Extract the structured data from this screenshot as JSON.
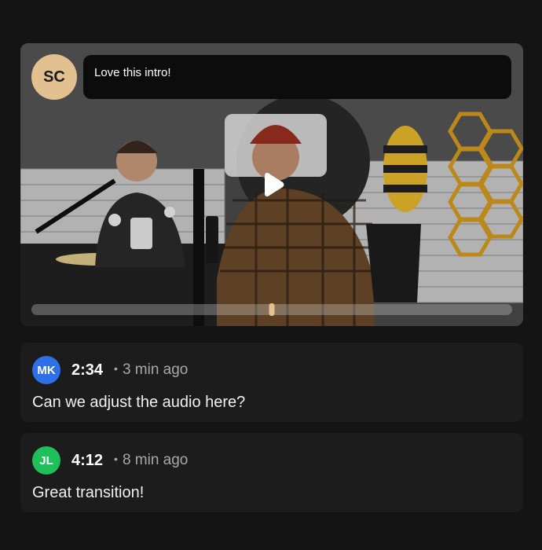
{
  "video": {
    "author_initials": "SC",
    "author_avatar_color": "#e2c08f",
    "overlay_comment": "Love this intro!",
    "progress": 0.5,
    "accent_color": "#e3c48c",
    "play_icon": "play-icon"
  },
  "comments": [
    {
      "initials": "MK",
      "avatar_color": "#2f6fe8",
      "timestamp": "2:34",
      "ago": "3 min ago",
      "text": "Can we adjust the audio here?"
    },
    {
      "initials": "JL",
      "avatar_color": "#1fbf5a",
      "timestamp": "4:12",
      "ago": "8 min ago",
      "text": "Great transition!"
    }
  ],
  "separator": "•"
}
